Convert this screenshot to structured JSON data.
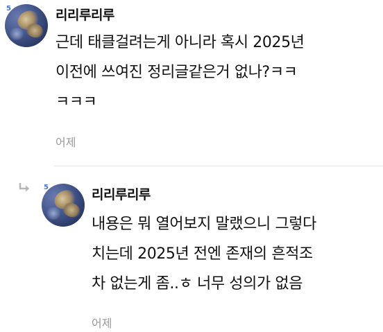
{
  "comments": [
    {
      "badge": "5",
      "nickname": "리리루리루",
      "lines": [
        "근데 태클걸려는게 아니라 혹시 2025년",
        "이전에 쓰여진 정리글같은거 없나?ㅋㅋ",
        "ㅋㅋㅋ"
      ],
      "timestamp": "어제"
    },
    {
      "badge": "5",
      "nickname": "리리루리루",
      "lines": [
        "내용은 뭐 열어보지 말랬으니 그렇다",
        "치는데 2025년 전엔 존재의 흔적조",
        "차 없는게 좀..ㅎ 너무 성의가 없음"
      ],
      "timestamp": "어제"
    }
  ],
  "icons": {
    "reply_indicator": "reply-arrow-icon",
    "level_badge": "level-badge-icon"
  },
  "colors": {
    "badge": "#4a74c9",
    "timestamp": "#9a9a9a",
    "divider": "#e6e6e6",
    "reply_icon": "#b8b8b8"
  }
}
